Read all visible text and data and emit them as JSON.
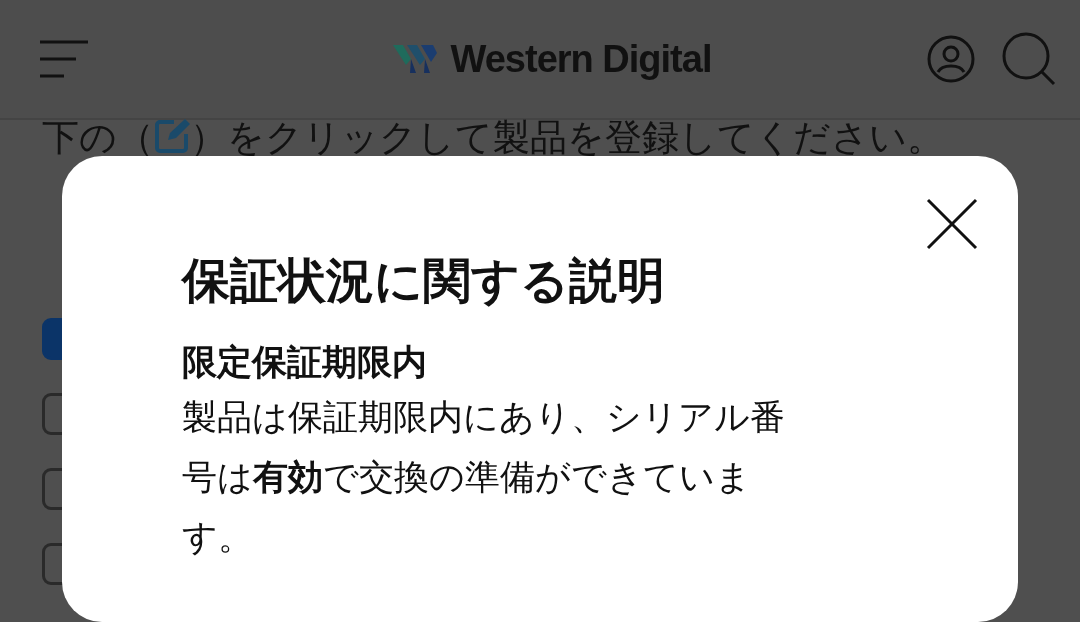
{
  "header": {
    "logo": "Western Digital"
  },
  "instruction": {
    "before": "下の（",
    "after": "）をクリックして製品を登録してください。"
  },
  "checkboxes": [
    {
      "checked": true
    },
    {
      "checked": false
    },
    {
      "checked": false
    },
    {
      "checked": false
    }
  ],
  "dialog": {
    "title": "保証状況に関する説明",
    "subtitle": "限定保証期限内",
    "body": "製品は保証期限内にあり、シリアル番号は**有効**で交換の準備ができています。"
  }
}
